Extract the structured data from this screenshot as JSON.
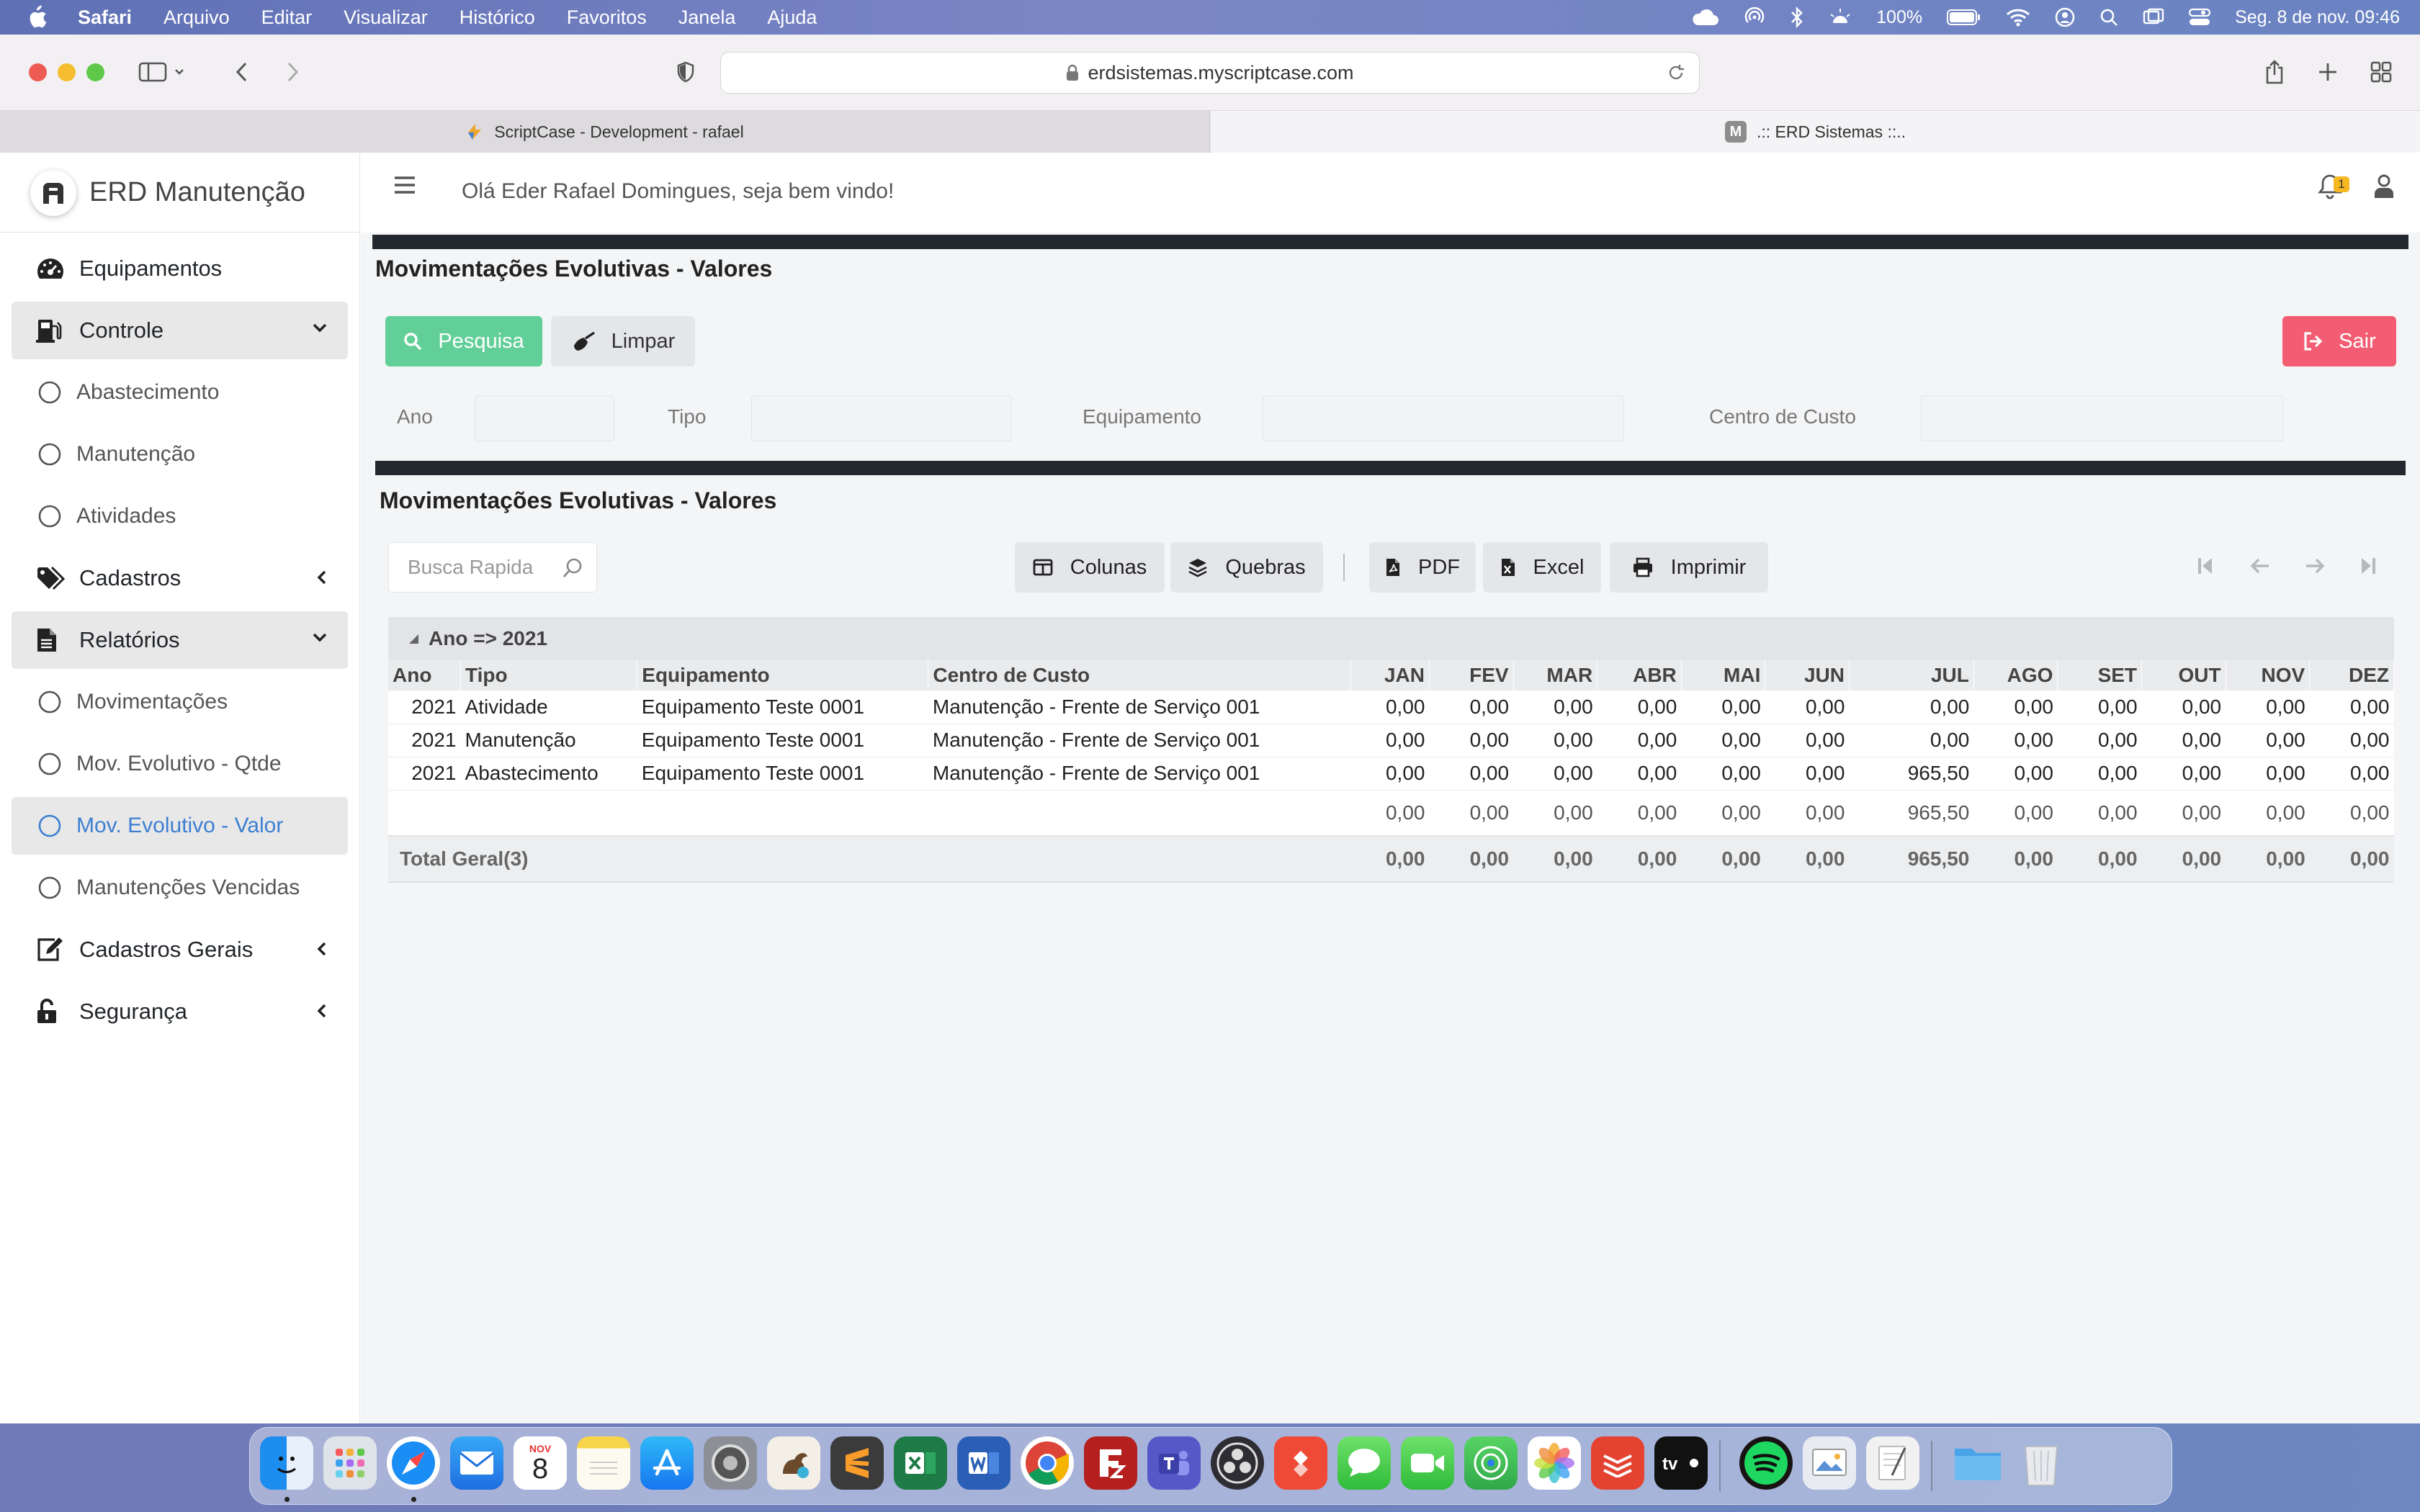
{
  "menubar": {
    "app": "Safari",
    "items": [
      "Arquivo",
      "Editar",
      "Visualizar",
      "Histórico",
      "Favoritos",
      "Janela",
      "Ajuda"
    ],
    "battery": "100%",
    "datetime": "Seg. 8 de nov.  09:46"
  },
  "browser": {
    "url": "erdsistemas.myscriptcase.com",
    "tabs": [
      {
        "title": "ScriptCase - Development - rafael"
      },
      {
        "title": ".:: ERD Sistemas ::..",
        "badge": "M"
      }
    ]
  },
  "sidebar": {
    "brand": "ERD Manutenção",
    "items": [
      {
        "label": "Equipamentos"
      },
      {
        "label": "Controle"
      },
      {
        "label": "Abastecimento"
      },
      {
        "label": "Manutenção"
      },
      {
        "label": "Atividades"
      },
      {
        "label": "Cadastros"
      },
      {
        "label": "Relatórios"
      },
      {
        "label": "Movimentações"
      },
      {
        "label": "Mov. Evolutivo - Qtde"
      },
      {
        "label": "Mov. Evolutivo - Valor"
      },
      {
        "label": "Manutenções Vencidas"
      },
      {
        "label": "Cadastros Gerais"
      },
      {
        "label": "Segurança"
      }
    ]
  },
  "header": {
    "welcome": "Olá Eder Rafael Domingues, seja bem vindo!",
    "notifications": "1"
  },
  "search_panel": {
    "title": "Movimentações Evolutivas - Valores",
    "search_label": "Pesquisa",
    "clear_label": "Limpar",
    "exit_label": "Sair",
    "filters": [
      "Ano",
      "Tipo",
      "Equipamento",
      "Centro de Custo"
    ]
  },
  "report": {
    "title": "Movimentações Evolutivas - Valores",
    "quick_search_placeholder": "Busca Rapida",
    "buttons": {
      "columns": "Colunas",
      "breaks": "Quebras",
      "pdf": "PDF",
      "excel": "Excel",
      "print": "Imprimir"
    },
    "group_label": "Ano => 2021",
    "columns": [
      "Ano",
      "Tipo",
      "Equipamento",
      "Centro de Custo",
      "JAN",
      "FEV",
      "MAR",
      "ABR",
      "MAI",
      "JUN",
      "JUL",
      "AGO",
      "SET",
      "OUT",
      "NOV",
      "DEZ"
    ],
    "rows": [
      [
        "2021",
        "Atividade",
        "Equipamento Teste 0001",
        "Manutenção - Frente de Serviço 001",
        "0,00",
        "0,00",
        "0,00",
        "0,00",
        "0,00",
        "0,00",
        "0,00",
        "0,00",
        "0,00",
        "0,00",
        "0,00",
        "0,00"
      ],
      [
        "2021",
        "Manutenção",
        "Equipamento Teste 0001",
        "Manutenção - Frente de Serviço 001",
        "0,00",
        "0,00",
        "0,00",
        "0,00",
        "0,00",
        "0,00",
        "0,00",
        "0,00",
        "0,00",
        "0,00",
        "0,00",
        "0,00"
      ],
      [
        "2021",
        "Abastecimento",
        "Equipamento Teste 0001",
        "Manutenção - Frente de Serviço 001",
        "0,00",
        "0,00",
        "0,00",
        "0,00",
        "0,00",
        "0,00",
        "965,50",
        "0,00",
        "0,00",
        "0,00",
        "0,00",
        "0,00"
      ]
    ],
    "subtotal": [
      "0,00",
      "0,00",
      "0,00",
      "0,00",
      "0,00",
      "0,00",
      "965,50",
      "0,00",
      "0,00",
      "0,00",
      "0,00",
      "0,00"
    ],
    "total_label": "Total Geral(3)",
    "total": [
      "0,00",
      "0,00",
      "0,00",
      "0,00",
      "0,00",
      "0,00",
      "965,50",
      "0,00",
      "0,00",
      "0,00",
      "0,00",
      "0,00"
    ]
  },
  "dock": {
    "calendar_month": "NOV",
    "calendar_day": "8",
    "apps": [
      "finder-icon",
      "launchpad-icon",
      "safari-icon",
      "mail-icon",
      "calendar-icon",
      "notes-icon",
      "app-store-icon",
      "system-preferences-icon",
      "squirrel-icon",
      "sublime-text-icon",
      "excel-icon",
      "word-icon",
      "chrome-icon",
      "filezilla-icon",
      "teams-icon",
      "obs-icon",
      "anydesk-icon",
      "messages-icon",
      "facetime-icon",
      "find-my-icon",
      "photos-icon",
      "todoist-icon",
      "apple-tv-icon",
      "spotify-icon",
      "preview-icon",
      "textedit-icon",
      "folder-icon",
      "trash-icon"
    ]
  }
}
